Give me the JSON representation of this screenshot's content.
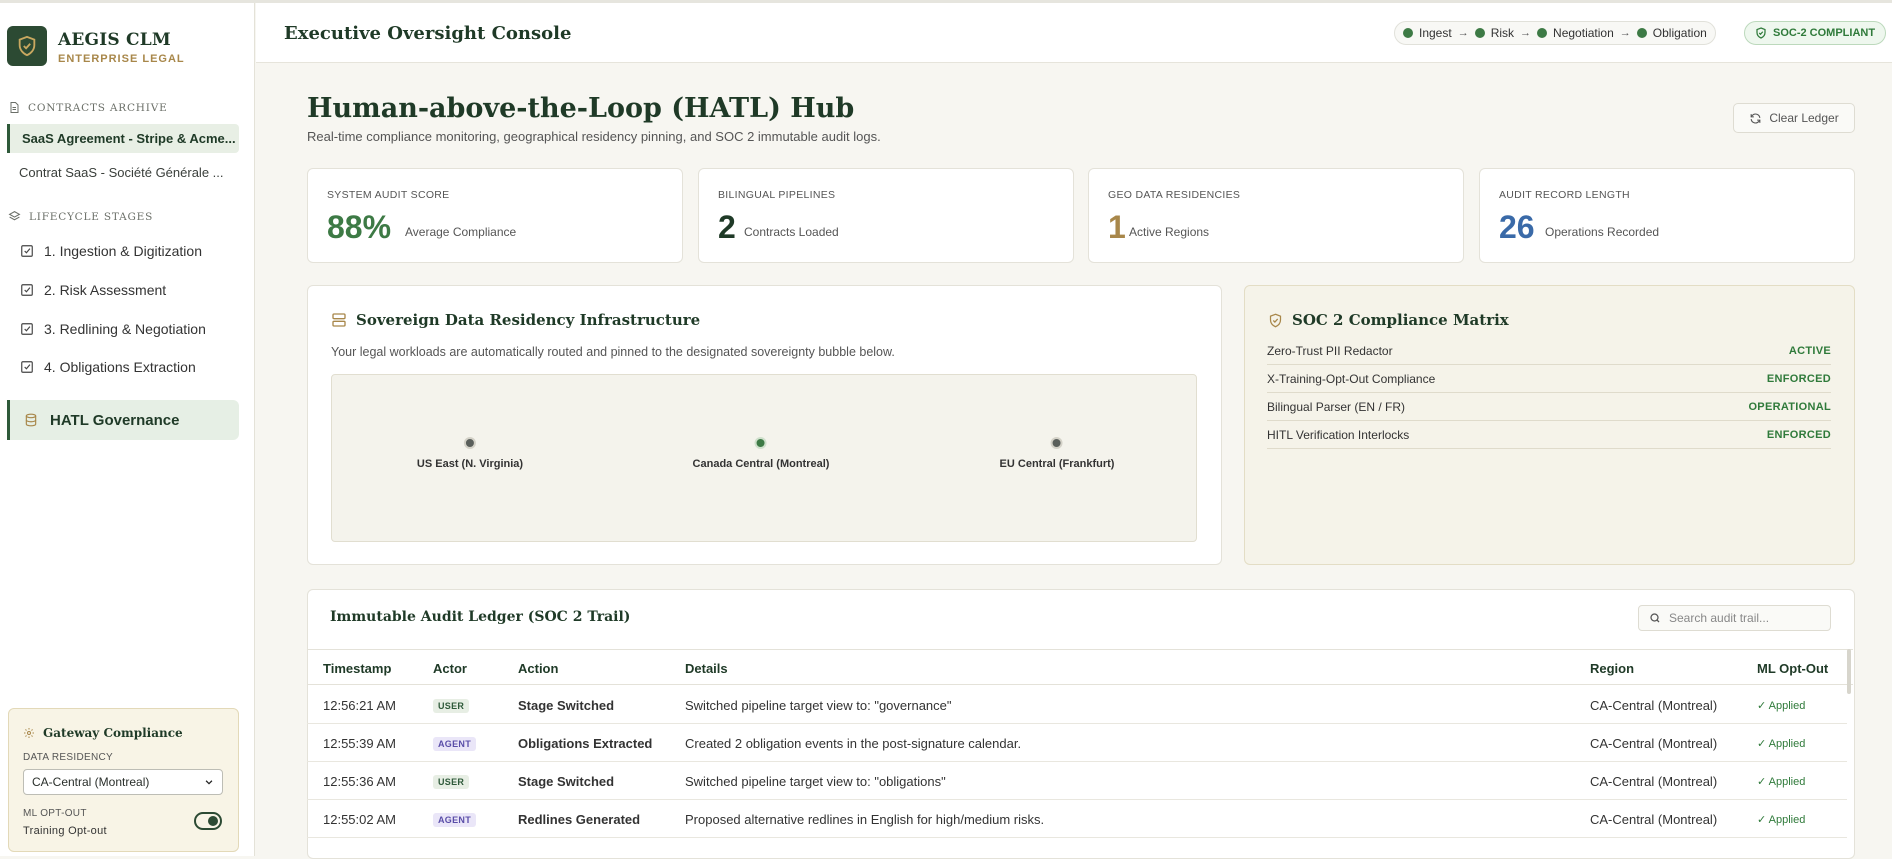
{
  "brand": {
    "name": "AEGIS CLM",
    "subtitle": "ENTERPRISE LEGAL"
  },
  "sidebar": {
    "contracts_heading": "CONTRACTS ARCHIVE",
    "contracts": [
      {
        "label": "SaaS Agreement - Stripe & Acme...",
        "active": true
      },
      {
        "label": "Contrat SaaS - Société Générale ...",
        "active": false
      }
    ],
    "stages_heading": "LIFECYCLE STAGES",
    "stages": [
      {
        "label": "1. Ingestion & Digitization"
      },
      {
        "label": "2. Risk Assessment"
      },
      {
        "label": "3. Redlining & Negotiation"
      },
      {
        "label": "4. Obligations Extraction"
      }
    ],
    "governance_label": "HATL Governance",
    "gateway": {
      "title": "Gateway Compliance",
      "residency_label": "DATA RESIDENCY",
      "residency_value": "CA-Central (Montreal)",
      "optout_label": "ML OPT-OUT",
      "optout_value": "Training Opt-out",
      "optout_enabled": true
    }
  },
  "header": {
    "title": "Executive Oversight Console",
    "pipeline": [
      "Ingest",
      "Risk",
      "Negotiation",
      "Obligation"
    ],
    "compliance_badge": "SOC-2 COMPLIANT"
  },
  "page": {
    "title": "Human-above-the-Loop (HATL) Hub",
    "subtitle": "Real-time compliance monitoring, geographical residency pinning, and SOC 2 immutable audit logs.",
    "clear_button": "Clear Ledger"
  },
  "kpis": [
    {
      "label": "SYSTEM AUDIT SCORE",
      "value": "88%",
      "sub": "Average Compliance",
      "color": "#3d7a45"
    },
    {
      "label": "BILINGUAL PIPELINES",
      "value": "2",
      "sub": "Contracts Loaded",
      "color": "#1f3a27"
    },
    {
      "label": "GEO DATA RESIDENCIES",
      "value": "1",
      "sub": "Active Regions",
      "color": "#a8874a"
    },
    {
      "label": "AUDIT RECORD LENGTH",
      "value": "26",
      "sub": "Operations Recorded",
      "color": "#3a6aa8"
    }
  ],
  "residency": {
    "title": "Sovereign Data Residency Infrastructure",
    "description": "Your legal workloads are automatically routed and pinned to the designated sovereignty bubble below.",
    "regions": [
      {
        "label": "US East (N. Virginia)",
        "active": false
      },
      {
        "label": "Canada Central (Montreal)",
        "active": true
      },
      {
        "label": "EU Central (Frankfurt)",
        "active": false
      }
    ]
  },
  "soc_matrix": {
    "title": "SOC 2 Compliance Matrix",
    "rows": [
      {
        "control": "Zero-Trust PII Redactor",
        "status": "ACTIVE"
      },
      {
        "control": "X-Training-Opt-Out Compliance",
        "status": "ENFORCED"
      },
      {
        "control": "Bilingual Parser (EN / FR)",
        "status": "OPERATIONAL"
      },
      {
        "control": "HITL Verification Interlocks",
        "status": "ENFORCED"
      }
    ]
  },
  "ledger": {
    "title": "Immutable Audit Ledger (SOC 2 Trail)",
    "search_placeholder": "Search audit trail...",
    "columns": [
      "Timestamp",
      "Actor",
      "Action",
      "Details",
      "Region",
      "ML Opt-Out"
    ],
    "rows": [
      {
        "time": "12:56:21 AM",
        "actor": "USER",
        "action": "Stage Switched",
        "details": "Switched pipeline target view to: \"governance\"",
        "region": "CA-Central (Montreal)",
        "optout": "✓ Applied"
      },
      {
        "time": "12:55:39 AM",
        "actor": "AGENT",
        "action": "Obligations Extracted",
        "details": "Created 2 obligation events in the post-signature calendar.",
        "region": "CA-Central (Montreal)",
        "optout": "✓ Applied"
      },
      {
        "time": "12:55:36 AM",
        "actor": "USER",
        "action": "Stage Switched",
        "details": "Switched pipeline target view to: \"obligations\"",
        "region": "CA-Central (Montreal)",
        "optout": "✓ Applied"
      },
      {
        "time": "12:55:02 AM",
        "actor": "AGENT",
        "action": "Redlines Generated",
        "details": "Proposed alternative redlines in English for high/medium risks.",
        "region": "CA-Central (Montreal)",
        "optout": "✓ Applied"
      }
    ]
  }
}
